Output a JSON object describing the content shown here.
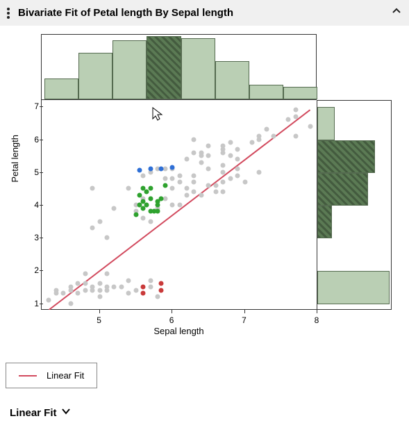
{
  "header": {
    "title": "Bivariate Fit of Petal length By Sepal length"
  },
  "legend": {
    "label": "Linear Fit"
  },
  "footer": {
    "label": "Linear Fit"
  },
  "chart_data": {
    "type": "scatter",
    "xlabel": "Sepal length",
    "ylabel": "Petal length",
    "xlim": [
      4.2,
      8.0
    ],
    "ylim": [
      0.8,
      7.2
    ],
    "x_ticks": [
      5,
      6,
      7,
      8
    ],
    "y_ticks": [
      1,
      2,
      3,
      4,
      5,
      6,
      7
    ],
    "fit_line": {
      "x1": 4.3,
      "y1": 0.8,
      "x2": 7.9,
      "y2": 6.9
    },
    "top_histogram": {
      "bin_edges": [
        4.24,
        4.71,
        5.18,
        5.65,
        6.12,
        6.59,
        7.06,
        7.53,
        8.0
      ],
      "counts": [
        10,
        22,
        28,
        30,
        29,
        18,
        7,
        6
      ],
      "selected_bin": 3
    },
    "right_histogram": {
      "bin_edges": [
        1,
        2,
        3,
        4,
        5,
        6,
        7
      ],
      "counts": [
        50,
        0,
        10,
        35,
        40,
        12
      ],
      "selected_bins": [
        2,
        3,
        4
      ]
    },
    "series": [
      {
        "name": "gray",
        "color": "#c7c7c7",
        "points": [
          [
            4.3,
            1.1
          ],
          [
            4.4,
            1.4
          ],
          [
            4.4,
            1.3
          ],
          [
            4.5,
            1.3
          ],
          [
            4.6,
            1.5
          ],
          [
            4.6,
            1.0
          ],
          [
            4.6,
            1.4
          ],
          [
            4.7,
            1.3
          ],
          [
            4.7,
            1.6
          ],
          [
            4.8,
            1.4
          ],
          [
            4.8,
            1.9
          ],
          [
            4.8,
            1.6
          ],
          [
            4.9,
            1.4
          ],
          [
            4.9,
            1.5
          ],
          [
            4.9,
            3.3
          ],
          [
            4.9,
            4.5
          ],
          [
            5.0,
            1.2
          ],
          [
            5.0,
            1.4
          ],
          [
            5.0,
            1.6
          ],
          [
            5.0,
            3.5
          ],
          [
            5.1,
            1.4
          ],
          [
            5.1,
            1.5
          ],
          [
            5.1,
            1.9
          ],
          [
            5.1,
            3.0
          ],
          [
            5.2,
            1.5
          ],
          [
            5.2,
            3.9
          ],
          [
            5.3,
            1.5
          ],
          [
            5.4,
            1.7
          ],
          [
            5.4,
            1.3
          ],
          [
            5.4,
            4.5
          ],
          [
            5.5,
            1.4
          ],
          [
            5.5,
            4.0
          ],
          [
            5.5,
            3.8
          ],
          [
            5.6,
            4.2
          ],
          [
            5.6,
            3.6
          ],
          [
            5.6,
            4.9
          ],
          [
            5.7,
            1.5
          ],
          [
            5.7,
            1.7
          ],
          [
            5.7,
            3.5
          ],
          [
            5.7,
            5.0
          ],
          [
            5.8,
            1.2
          ],
          [
            5.8,
            5.1
          ],
          [
            5.8,
            3.9
          ],
          [
            5.9,
            4.2
          ],
          [
            5.9,
            4.8
          ],
          [
            5.9,
            5.1
          ],
          [
            6.0,
            4.0
          ],
          [
            6.0,
            4.5
          ],
          [
            6.0,
            5.1
          ],
          [
            6.0,
            4.8
          ],
          [
            6.1,
            4.7
          ],
          [
            6.1,
            4.0
          ],
          [
            6.1,
            4.9
          ],
          [
            6.2,
            4.3
          ],
          [
            6.2,
            5.4
          ],
          [
            6.2,
            4.5
          ],
          [
            6.3,
            4.4
          ],
          [
            6.3,
            4.7
          ],
          [
            6.3,
            4.9
          ],
          [
            6.3,
            5.6
          ],
          [
            6.3,
            6.0
          ],
          [
            6.4,
            4.3
          ],
          [
            6.4,
            5.3
          ],
          [
            6.4,
            5.5
          ],
          [
            6.4,
            5.6
          ],
          [
            6.5,
            4.6
          ],
          [
            6.5,
            5.1
          ],
          [
            6.5,
            5.5
          ],
          [
            6.5,
            5.8
          ],
          [
            6.6,
            4.4
          ],
          [
            6.6,
            4.6
          ],
          [
            6.7,
            4.4
          ],
          [
            6.7,
            4.7
          ],
          [
            6.7,
            5.0
          ],
          [
            6.7,
            5.2
          ],
          [
            6.7,
            5.6
          ],
          [
            6.7,
            5.7
          ],
          [
            6.7,
            5.8
          ],
          [
            6.8,
            4.8
          ],
          [
            6.8,
            5.5
          ],
          [
            6.8,
            5.9
          ],
          [
            6.9,
            4.9
          ],
          [
            6.9,
            5.1
          ],
          [
            6.9,
            5.4
          ],
          [
            6.9,
            5.7
          ],
          [
            7.0,
            4.7
          ],
          [
            7.1,
            5.9
          ],
          [
            7.2,
            5.0
          ],
          [
            7.2,
            6.0
          ],
          [
            7.2,
            6.1
          ],
          [
            7.3,
            6.3
          ],
          [
            7.4,
            6.1
          ],
          [
            7.6,
            6.6
          ],
          [
            7.7,
            6.1
          ],
          [
            7.7,
            6.7
          ],
          [
            7.7,
            6.9
          ],
          [
            7.9,
            6.4
          ]
        ]
      },
      {
        "name": "green",
        "color": "#2ea22e",
        "points": [
          [
            5.5,
            3.7
          ],
          [
            5.55,
            4.3
          ],
          [
            5.6,
            4.5
          ],
          [
            5.6,
            3.9
          ],
          [
            5.6,
            4.1
          ],
          [
            5.65,
            4.0
          ],
          [
            5.7,
            4.2
          ],
          [
            5.7,
            4.5
          ],
          [
            5.75,
            3.8
          ],
          [
            5.8,
            4.0
          ],
          [
            5.8,
            4.1
          ],
          [
            5.85,
            4.2
          ],
          [
            5.9,
            4.6
          ],
          [
            5.7,
            3.8
          ],
          [
            5.55,
            4.0
          ],
          [
            5.8,
            3.8
          ],
          [
            5.65,
            4.4
          ]
        ]
      },
      {
        "name": "blue",
        "color": "#2e6fd6",
        "points": [
          [
            5.55,
            5.05
          ],
          [
            5.7,
            5.1
          ],
          [
            5.85,
            5.1
          ],
          [
            6.0,
            5.15
          ]
        ]
      },
      {
        "name": "red",
        "color": "#c93a3a",
        "points": [
          [
            5.6,
            1.5
          ],
          [
            5.6,
            1.3
          ],
          [
            5.85,
            1.6
          ],
          [
            5.85,
            1.4
          ]
        ]
      }
    ]
  }
}
